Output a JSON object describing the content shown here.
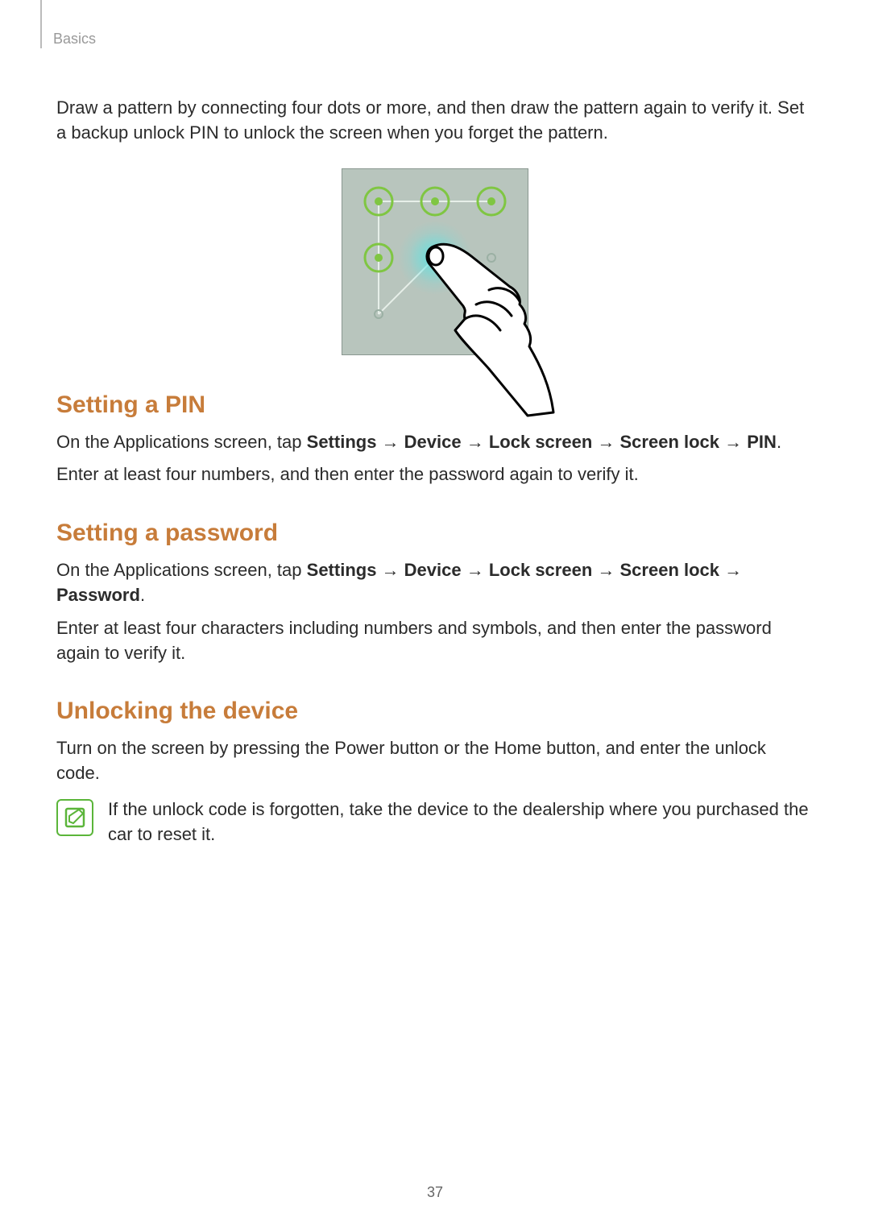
{
  "header": {
    "section": "Basics"
  },
  "intro": "Draw a pattern by connecting four dots or more, and then draw the pattern again to verify it. Set a backup unlock PIN to unlock the screen when you forget the pattern.",
  "sections": {
    "pin": {
      "title": "Setting a PIN",
      "path_prefix": "On the Applications screen, tap ",
      "path": [
        "Settings",
        "Device",
        "Lock screen",
        "Screen lock",
        "PIN"
      ],
      "body": "Enter at least four numbers, and then enter the password again to verify it."
    },
    "password": {
      "title": "Setting a password",
      "path_prefix": "On the Applications screen, tap ",
      "path": [
        "Settings",
        "Device",
        "Lock screen",
        "Screen lock",
        "Password"
      ],
      "body": "Enter at least four characters including numbers and symbols, and then enter the password again to verify it."
    },
    "unlock": {
      "title": "Unlocking the device",
      "body": "Turn on the screen by pressing the Power button or the Home button, and enter the unlock code.",
      "note": "If the unlock code is forgotten, take the device to the dealership where you purchased the car to reset it."
    }
  },
  "arrow": " → ",
  "page_number": "37"
}
